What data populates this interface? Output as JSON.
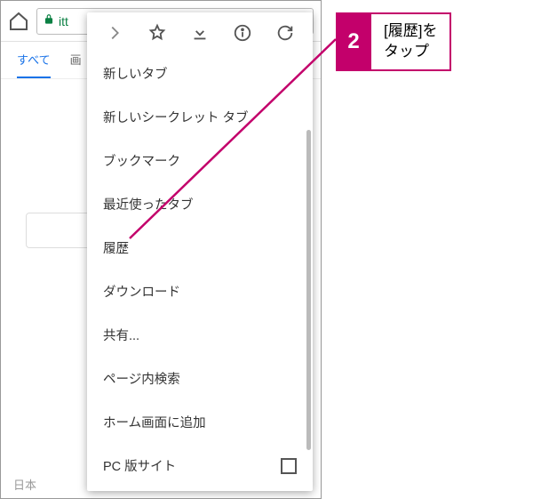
{
  "address_bar": {
    "url_fragment": "itt"
  },
  "tabs": {
    "items": [
      {
        "label": "すべて",
        "active": true
      },
      {
        "label": "画"
      }
    ]
  },
  "bottom_hint": "日本",
  "menu": {
    "items": [
      {
        "label": "新しいタブ"
      },
      {
        "label": "新しいシークレット タブ"
      },
      {
        "label": "ブックマーク"
      },
      {
        "label": "最近使ったタブ"
      },
      {
        "label": "履歴"
      },
      {
        "label": "ダウンロード"
      },
      {
        "label": "共有..."
      },
      {
        "label": "ページ内検索"
      },
      {
        "label": "ホーム画面に追加"
      },
      {
        "label": "PC 版サイト",
        "checkbox": true
      }
    ]
  },
  "callout": {
    "num": "2",
    "line1": "[履歴]を",
    "line2": "タップ"
  }
}
